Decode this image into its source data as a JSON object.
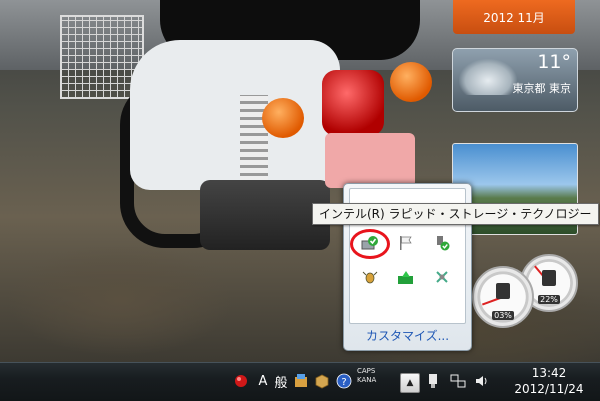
{
  "gadgets": {
    "calendar": {
      "label": "2012 11月"
    },
    "weather": {
      "temperature": "11°",
      "location": "東京都 東京"
    },
    "meters": {
      "cpu_percent": "03%",
      "memory_percent": "22%"
    }
  },
  "tray_popup": {
    "tooltip": "インテル(R) ラピッド・ストレージ・テクノロジー",
    "customize_label": "カスタマイズ...",
    "icons": [
      "intel-rst-icon",
      "flag-icon",
      "usb-safe-remove-icon",
      "bug-icon",
      "green-arrow-icon",
      "network-tool-icon"
    ]
  },
  "taskbar": {
    "ime_mode": "A",
    "ime_kanji": "般",
    "caps_label": "CAPS",
    "kana_label": "KANA",
    "clock_time": "13:42",
    "clock_date": "2012/11/24"
  },
  "colors": {
    "accent_orange": "#e0601a",
    "highlight_red": "#e8141c",
    "taskbar": "#181d20",
    "link_blue": "#1e57b5"
  }
}
